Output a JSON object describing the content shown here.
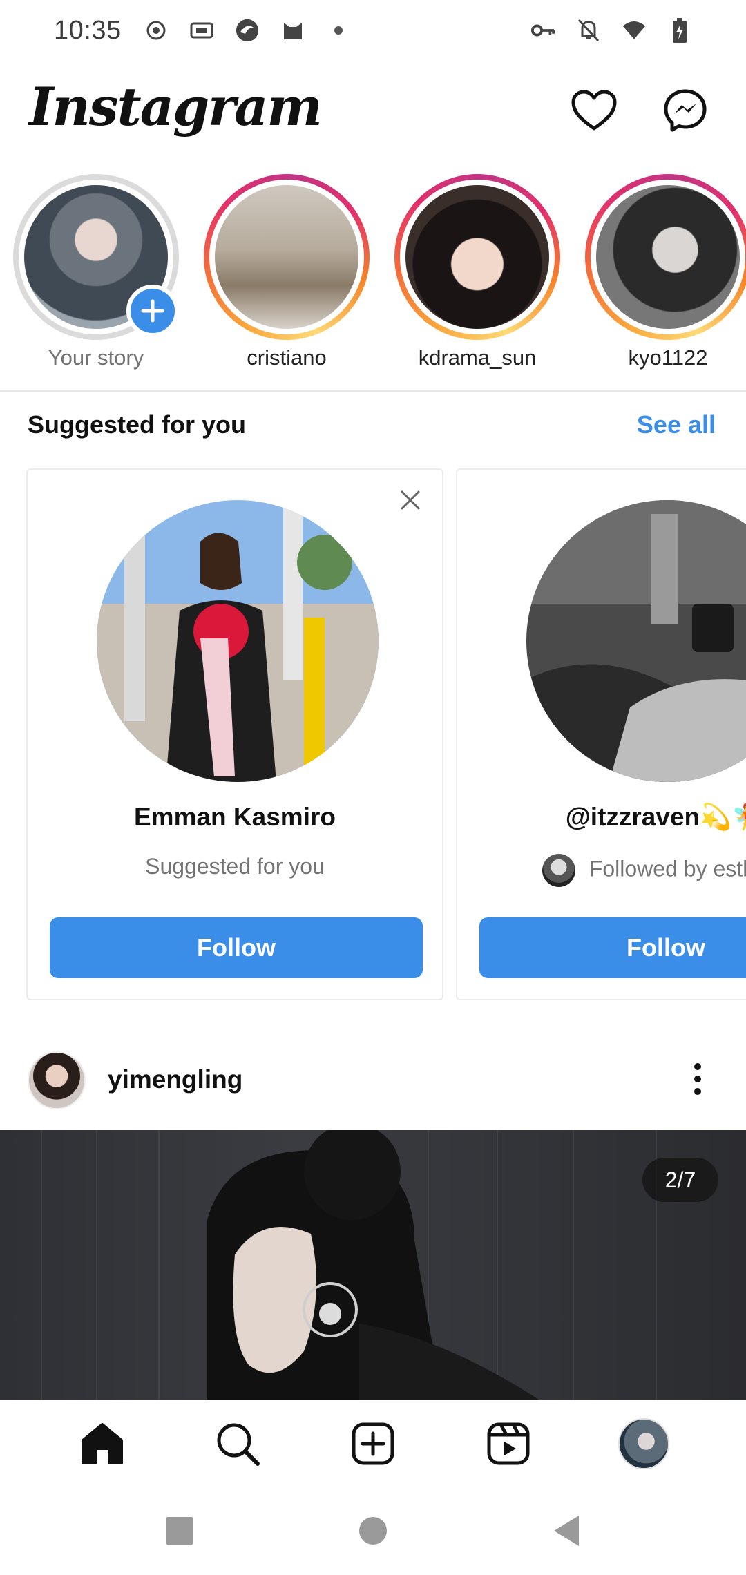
{
  "status_bar": {
    "time": "10:35",
    "left_icons": [
      "record-icon",
      "iqiyi-icon",
      "browser-icon",
      "cat-icon",
      "dot-icon"
    ],
    "right_icons": [
      "vpn-key-icon",
      "bell-off-icon",
      "wifi-icon",
      "battery-charging-icon"
    ]
  },
  "header": {
    "logo": "Instagram",
    "icons": [
      "heart-icon",
      "messenger-icon"
    ]
  },
  "stories": [
    {
      "label": "Your story",
      "seen": true,
      "own": true
    },
    {
      "label": "cristiano",
      "seen": false
    },
    {
      "label": "kdrama_sun",
      "seen": false
    },
    {
      "label": "kyo1122",
      "seen": false
    }
  ],
  "suggested": {
    "title": "Suggested for you",
    "see_all": "See all",
    "cards": [
      {
        "name": "Emman Kasmiro",
        "subtitle": "Suggested for you",
        "button": "Follow"
      },
      {
        "name": "@itzzraven💫🧚",
        "subtitle": "Followed by esther_",
        "button": "Follow"
      }
    ]
  },
  "post": {
    "username": "yimengling",
    "counter": "2/7"
  },
  "bottom_nav": {
    "items": [
      "home-icon",
      "search-icon",
      "create-icon",
      "reels-icon",
      "profile-avatar"
    ]
  },
  "system_nav": [
    "recents-icon",
    "home-circle-icon",
    "back-icon"
  ],
  "colors": {
    "accent": "#3b8ee8",
    "text": "#111111",
    "muted": "#737373"
  }
}
